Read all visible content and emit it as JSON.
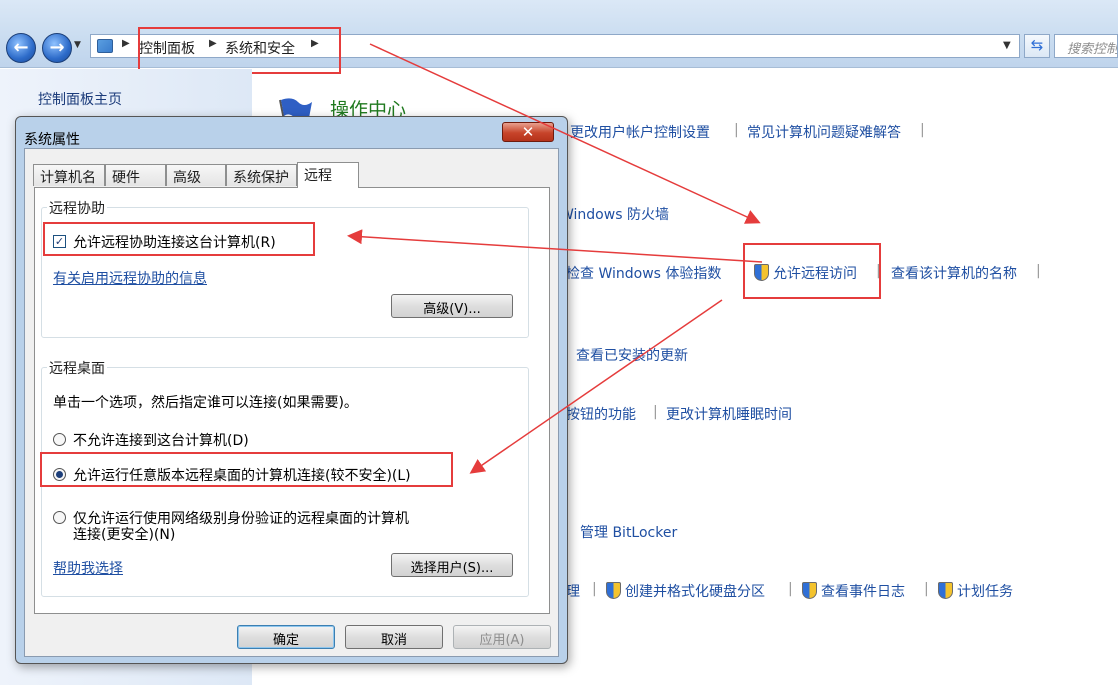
{
  "explorer": {
    "breadcrumb": [
      "控制面板",
      "系统和安全"
    ],
    "search_placeholder": "搜索控制",
    "left_pane": {
      "home_link": "控制面板主页"
    },
    "action_center": {
      "title": "操作中心",
      "links": [
        "更改用户帐户控制设置",
        "常见计算机问题疑难解答"
      ]
    },
    "firewall_link": "Windows 防火墙",
    "system_links": [
      "检查 Windows 体验指数",
      "允许远程访问",
      "查看该计算机的名称"
    ],
    "update_link": "查看已安装的更新",
    "power_links": [
      "按钮的功能",
      "更改计算机睡眠时间"
    ],
    "bitlocker_link": "管理 BitLocker",
    "admin_links": [
      "理",
      "创建并格式化硬盘分区",
      "查看事件日志",
      "计划任务"
    ]
  },
  "dialog": {
    "title": "系统属性",
    "close_glyph": "✕",
    "tabs": [
      "计算机名",
      "硬件",
      "高级",
      "系统保护",
      "远程"
    ],
    "remote_assistance": {
      "group_title": "远程协助",
      "checkbox_label": "允许远程协助连接这台计算机(R)",
      "checkbox_mark": "✓",
      "info_link": "有关启用远程协助的信息",
      "advanced_button": "高级(V)..."
    },
    "remote_desktop": {
      "group_title": "远程桌面",
      "instruction": "单击一个选项，然后指定谁可以连接(如果需要)。",
      "option_none": "不允许连接到这台计算机(D)",
      "option_any": "允许运行任意版本远程桌面的计算机连接(较不安全)(L)",
      "option_nla_line1": "仅允许运行使用网络级别身份验证的远程桌面的计算机",
      "option_nla_line2": "连接(更安全)(N)",
      "help_link": "帮助我选择",
      "select_users_button": "选择用户(S)..."
    },
    "buttons": {
      "ok": "确定",
      "cancel": "取消",
      "apply": "应用(A)"
    }
  },
  "colors": {
    "annotation": "#e53c3c",
    "link": "#1f4fa2",
    "title_green": "#207a1f"
  }
}
